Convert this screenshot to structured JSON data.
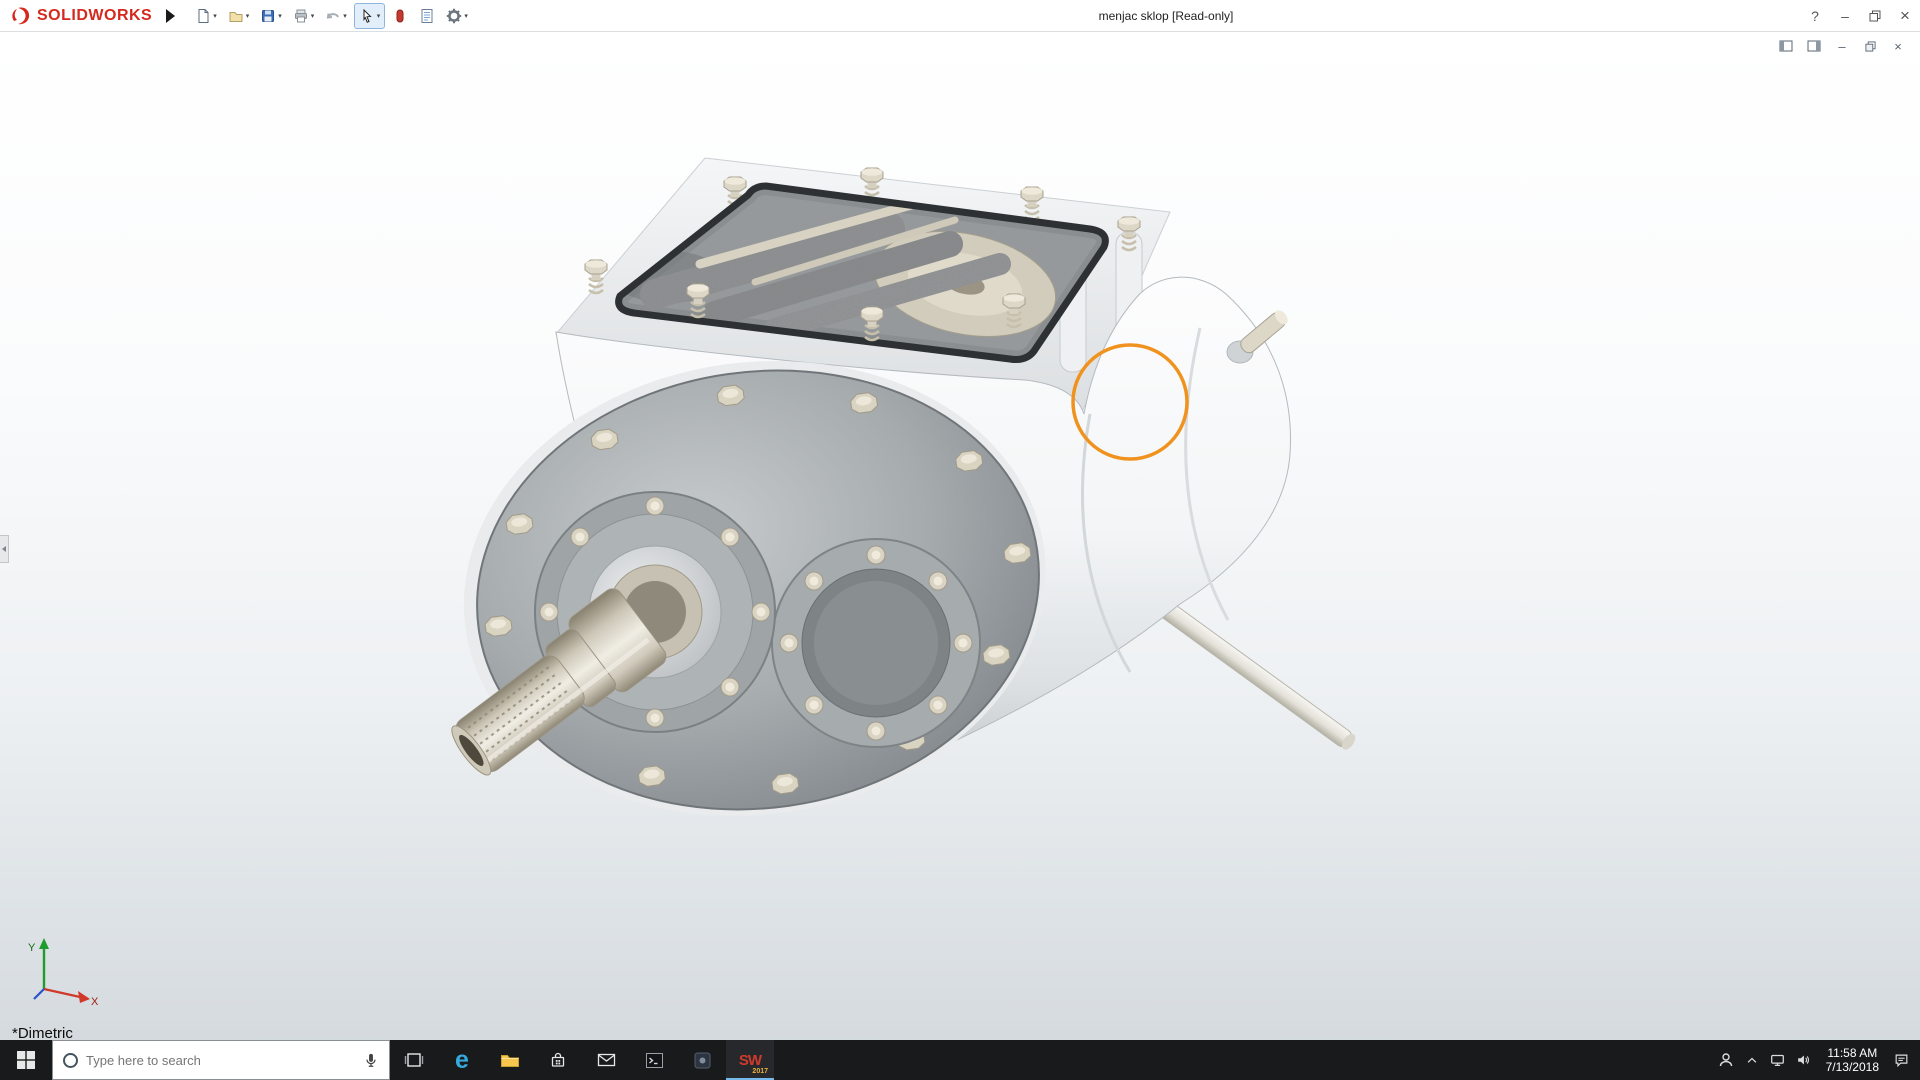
{
  "titlebar": {
    "brand": "SOLIDWORKS",
    "title": "menjac sklop [Read-only]",
    "help_glyph": "?",
    "minimize_glyph": "–",
    "close_glyph": "×"
  },
  "glyphs": {
    "caret": "▾"
  },
  "doc_controls": {
    "minimize_glyph": "–",
    "close_glyph": "×"
  },
  "viewport": {
    "orientation": "*Dimetric",
    "triad": {
      "x": "X",
      "y": "Y"
    }
  },
  "model": {
    "highlight_color": "#F0921E"
  },
  "taskbar": {
    "search_placeholder": "Type here to search",
    "clock": {
      "time": "11:58 AM",
      "date": "7/13/2018"
    }
  },
  "apps": {
    "edge_glyph": "e",
    "solidworks_badge": "SW",
    "solidworks_year": "2017"
  }
}
